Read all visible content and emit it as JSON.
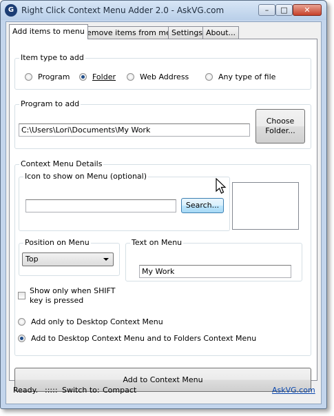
{
  "window": {
    "title": "Right Click Context Menu Adder 2.0  -  AskVG.com",
    "app_icon_glyph": "G"
  },
  "titlebar_buttons": {
    "minimize": "–",
    "maximize": "□",
    "close": "✕"
  },
  "tabs": [
    {
      "label": "Add items to menu",
      "active": true
    },
    {
      "label": "Remove items from menu",
      "active": false
    },
    {
      "label": "Settings",
      "active": false
    },
    {
      "label": "About...",
      "active": false
    }
  ],
  "item_type": {
    "label": "Item type to add",
    "options": [
      {
        "label": "Program",
        "checked": false
      },
      {
        "label": "Folder",
        "checked": true
      },
      {
        "label": "Web Address",
        "checked": false
      },
      {
        "label": "Any type of file",
        "checked": false
      }
    ]
  },
  "program": {
    "label": "Program to add",
    "path_value": "C:\\Users\\Lori\\Documents\\My Work",
    "choose_button": "Choose Folder..."
  },
  "context_details": {
    "label": "Context Menu Details",
    "icon_group_label": "Icon to show on Menu (optional)",
    "icon_path_value": "",
    "search_button": "Search...",
    "position_label": "Position on Menu",
    "position_value": "Top",
    "text_label": "Text on Menu",
    "text_value": "My Work",
    "shift_checkbox_label_1": "Show only when SHIFT",
    "shift_checkbox_label_2": "key is pressed",
    "shift_checked": false,
    "scope_options": [
      {
        "label": "Add only to Desktop Context Menu",
        "checked": false
      },
      {
        "label": "Add to Desktop Context Menu and to Folders Context Menu",
        "checked": true
      }
    ]
  },
  "add_button": "Add to Context Menu",
  "status": {
    "text": "Ready.",
    "grip": ":::::",
    "switch_to_label": "Switch to:",
    "switch_mode": "Compact",
    "link": "AskVG.com"
  },
  "colors": {
    "accent": "#1f4d8a",
    "link": "#0645ad",
    "window_frame": "#c3d5ec"
  }
}
